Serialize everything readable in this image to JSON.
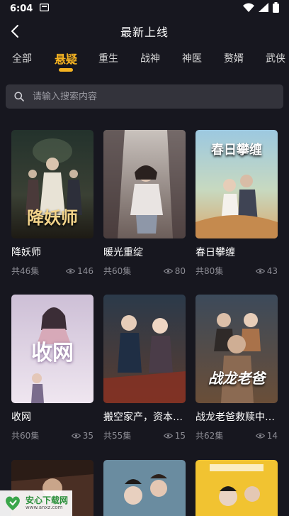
{
  "status_bar": {
    "time": "6:04"
  },
  "header": {
    "title": "最新上线"
  },
  "tabs": [
    {
      "label": "全部"
    },
    {
      "label": "悬疑"
    },
    {
      "label": "重生"
    },
    {
      "label": "战神"
    },
    {
      "label": "神医"
    },
    {
      "label": "赘婿"
    },
    {
      "label": "武侠"
    }
  ],
  "active_tab": "悬疑",
  "search": {
    "placeholder": "请输入搜索内容",
    "value": ""
  },
  "dramas": [
    {
      "title": "降妖师",
      "episodes": "共46集",
      "views": "146",
      "poster_text": "降妖师"
    },
    {
      "title": "暖光重绽",
      "episodes": "共60集",
      "views": "80",
      "poster_text": ""
    },
    {
      "title": "春日攀缠",
      "episodes": "共80集",
      "views": "43",
      "poster_text": "春日攀缠"
    },
    {
      "title": "收网",
      "episodes": "共60集",
      "views": "35",
      "poster_text": "收网"
    },
    {
      "title": "搬空家产，资本…",
      "episodes": "共55集",
      "views": "15",
      "poster_text": ""
    },
    {
      "title": "战龙老爸救赎中…",
      "episodes": "共62集",
      "views": "14",
      "poster_text": "战龙老爸"
    }
  ],
  "watermark": {
    "title": "安心下载网",
    "url": "www.anxz.com"
  },
  "colors": {
    "background": "#17171f",
    "accent": "#f5b321",
    "search_bg": "#33333b",
    "muted": "#8c8c94"
  }
}
